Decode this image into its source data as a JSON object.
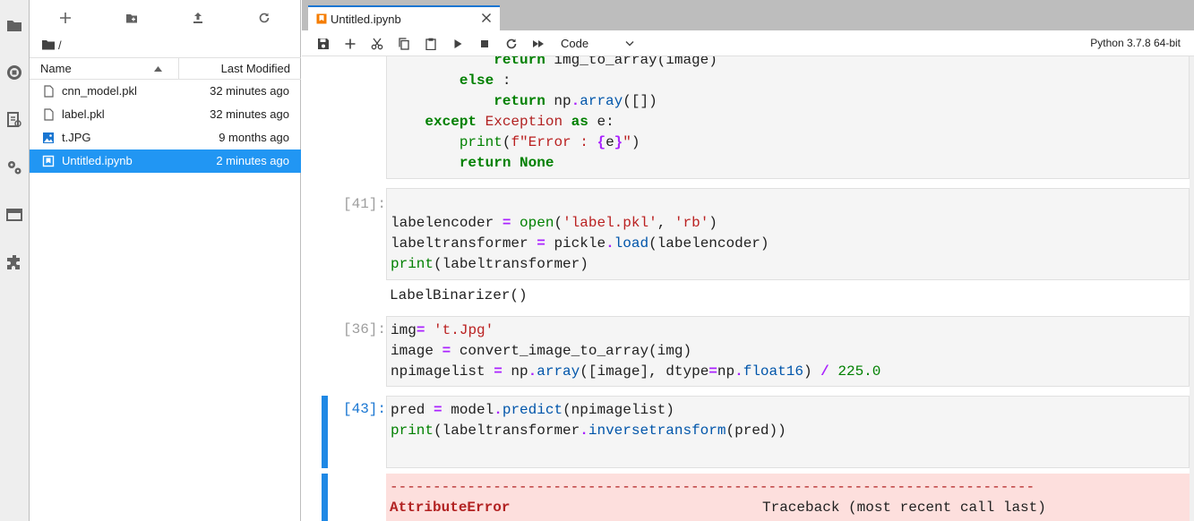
{
  "activity_bar": {
    "items": [
      {
        "name": "folder-icon"
      },
      {
        "name": "running-icon"
      },
      {
        "name": "commands-icon"
      },
      {
        "name": "property-inspector-icon"
      },
      {
        "name": "tabs-icon"
      },
      {
        "name": "extensions-icon"
      }
    ]
  },
  "file_browser": {
    "breadcrumb": "/",
    "columns": {
      "name": "Name",
      "modified": "Last Modified"
    },
    "files": [
      {
        "name": "cnn_model.pkl",
        "modified": "32 minutes ago",
        "icon": "file-icon"
      },
      {
        "name": "label.pkl",
        "modified": "32 minutes ago",
        "icon": "file-icon"
      },
      {
        "name": "t.JPG",
        "modified": "9 months ago",
        "icon": "image-icon"
      },
      {
        "name": "Untitled.ipynb",
        "modified": "2 minutes ago",
        "icon": "notebook-icon"
      }
    ]
  },
  "tab": {
    "label": "Untitled.ipynb"
  },
  "notebook_toolbar": {
    "cell_type": "Code",
    "kernel": "Python 3.7.8 64-bit"
  },
  "cells": {
    "c0": {
      "lines": [
        "            return img_to_array(image)",
        "        else :",
        "            return np.array([])",
        "    except Exception as e:",
        "        print(f\"Error : {e}\")",
        "        return None"
      ]
    },
    "c1": {
      "prompt": "[41]:",
      "lines": [
        "labelencoder = open('label.pkl', 'rb')",
        "labeltransformer = pickle.load(labelencoder)",
        "print(labeltransformer)"
      ],
      "output": "LabelBinarizer()"
    },
    "c2": {
      "prompt": "[36]:",
      "lines": [
        "img= 't.Jpg'",
        "image = convert_image_to_array(img)",
        "npimagelist = np.array([image], dtype=np.float16) / 225.0"
      ]
    },
    "c3": {
      "prompt": "[43]:",
      "lines": [
        "pred = model.predict(npimagelist)",
        "print(labeltransformer.inversetransform(pred))"
      ],
      "error": {
        "dashes": "---------------------------------------------------------------------------",
        "name": "AttributeError",
        "traceback": "Traceback (most recent call last)"
      }
    }
  },
  "colors": {
    "accent": "#1976d2",
    "selection": "#2196f3",
    "cell_bg": "#f5f5f5",
    "error_bg": "#fddfdd"
  }
}
